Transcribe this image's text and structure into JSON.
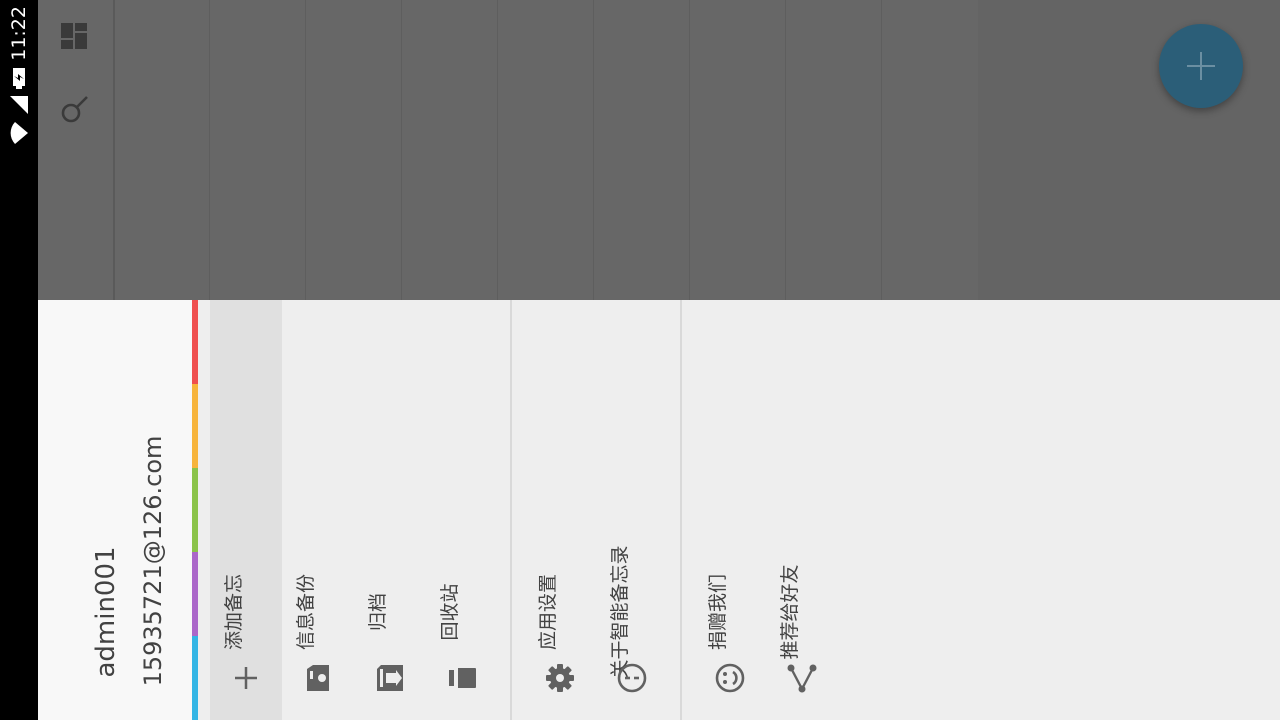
{
  "status_bar": {
    "time": "11:22"
  },
  "background_app": {
    "toolbar": {
      "icons": [
        "dashboard-icon",
        "search-icon"
      ]
    },
    "fab": {
      "icon": "plus-icon",
      "color": "#2b5e78"
    }
  },
  "drawer": {
    "user": {
      "name": "admin001",
      "email": "15935721@126.com"
    },
    "category_colors": [
      "#ef4f4f",
      "#f7b43b",
      "#8bc34a",
      "#ab67c9",
      "#33b5e5"
    ],
    "menu_groups": [
      [
        {
          "label": "添加备忘",
          "icon": "plus-icon",
          "selected": true
        },
        {
          "label": "信息备份",
          "icon": "backup-icon"
        },
        {
          "label": "归档",
          "icon": "archive-icon"
        },
        {
          "label": "回收站",
          "icon": "trash-icon"
        }
      ],
      [
        {
          "label": "应用设置",
          "icon": "gear-icon"
        },
        {
          "label": "关于智能备忘录",
          "icon": "info-circle-icon"
        }
      ],
      [
        {
          "label": "捐赠我们",
          "icon": "smile-icon"
        },
        {
          "label": "推荐给好友",
          "icon": "share-icon"
        }
      ]
    ]
  }
}
